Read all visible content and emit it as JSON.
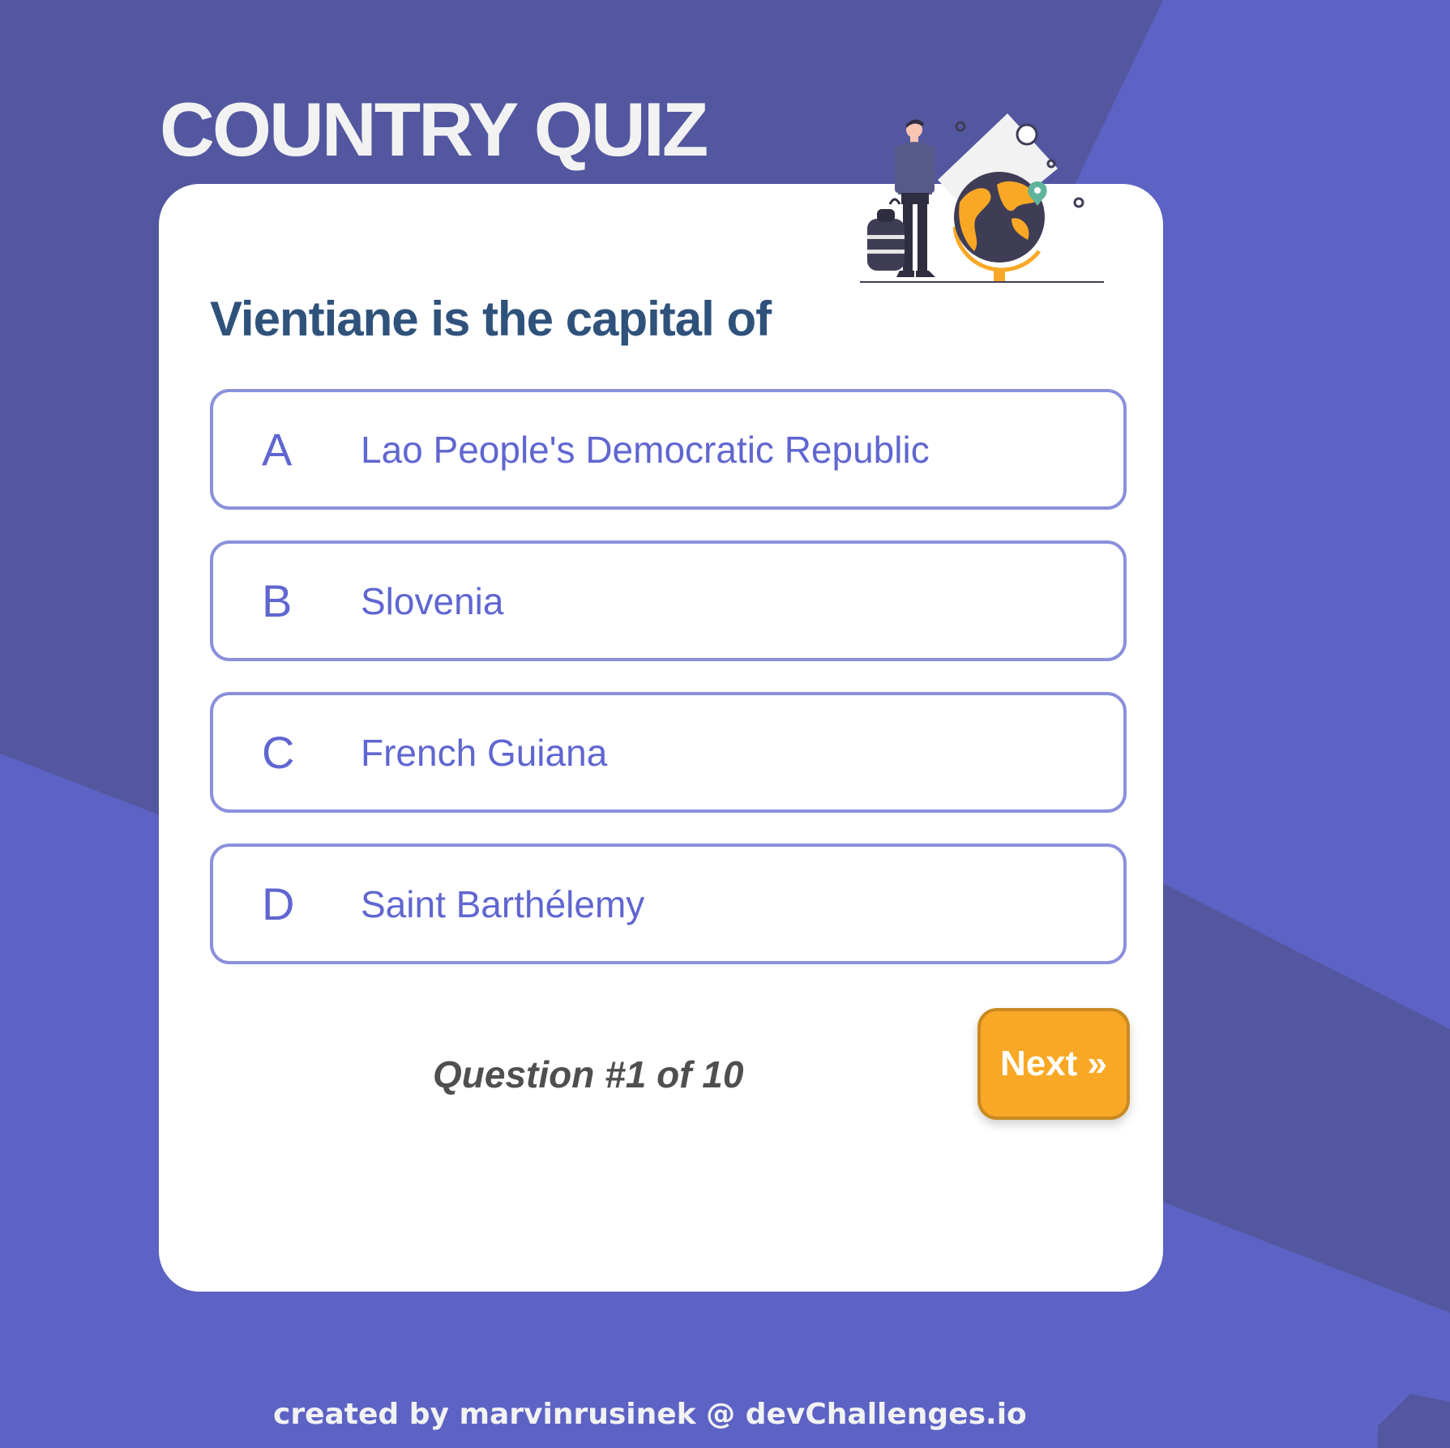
{
  "app": {
    "title": "COUNTRY QUIZ"
  },
  "quiz": {
    "question": "Vientiane is the capital of",
    "options": [
      {
        "letter": "A",
        "text": "Lao People's Democratic Republic"
      },
      {
        "letter": "B",
        "text": "Slovenia"
      },
      {
        "letter": "C",
        "text": "French Guiana"
      },
      {
        "letter": "D",
        "text": "Saint Barthélemy"
      }
    ],
    "progress": "Question #1 of 10",
    "next_label": "Next »"
  },
  "footer": {
    "credit": "created by marvinrusinek @ devChallenges.io"
  },
  "colors": {
    "background_dark": "#52579f",
    "background_light": "#5d63c4",
    "card": "#ffffff",
    "question_text": "#2f527b",
    "option_text": "#6066d0",
    "option_border": "#8b90db",
    "next_button": "#f9a826",
    "illustration_accent": "#f9a826"
  },
  "illustration": {
    "icon": "traveler-with-globe-illustration"
  }
}
